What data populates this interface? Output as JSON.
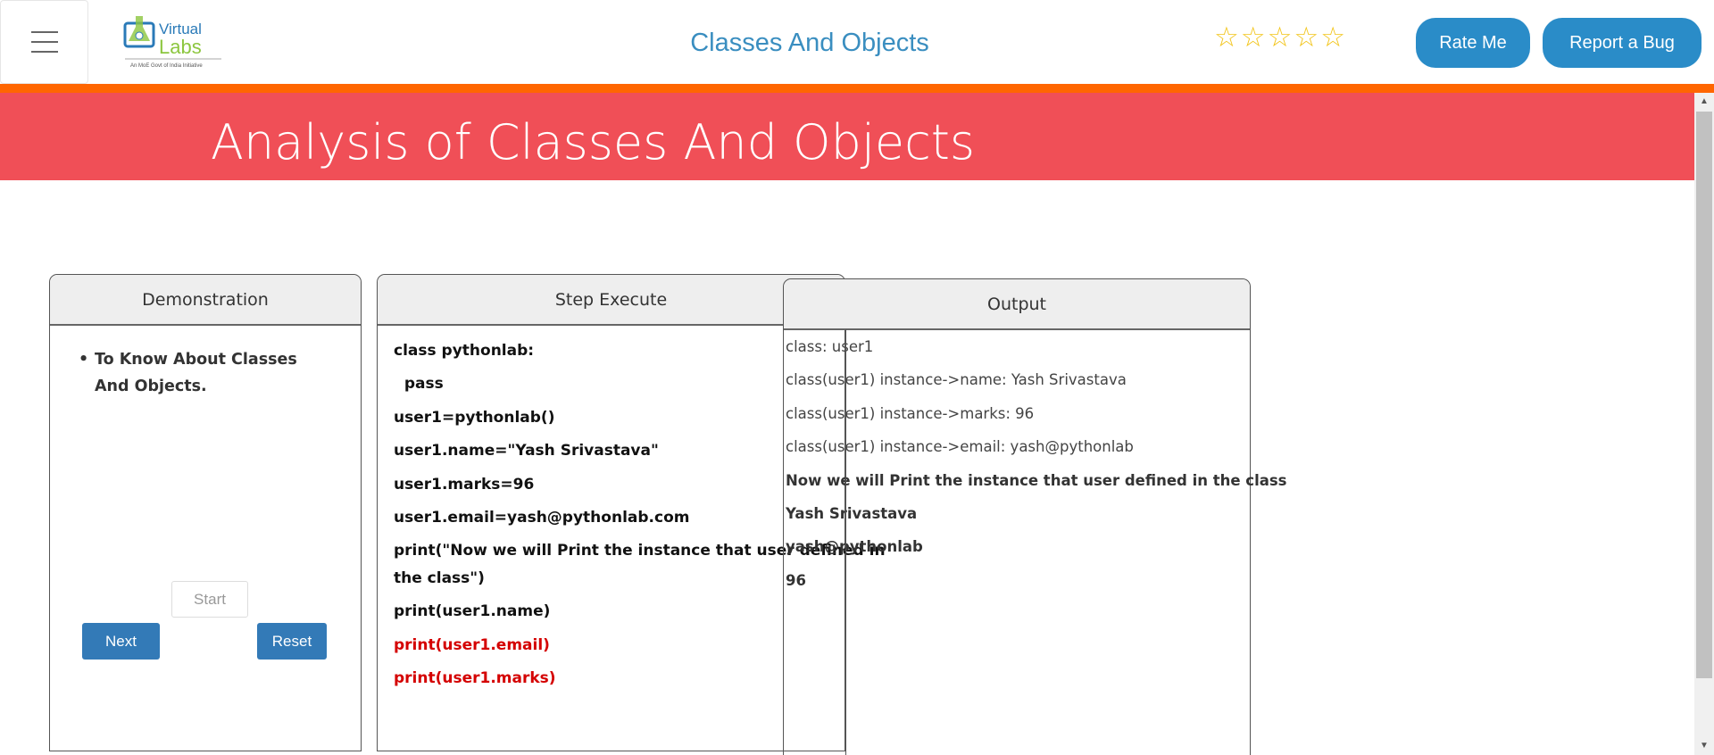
{
  "header": {
    "title": "Classes And Objects",
    "logo_text": "Virtual Labs",
    "logo_tagline": "An MoE Govt of India Initiative",
    "rating_stars": 5,
    "rating_value": 0,
    "rate_me": "Rate Me",
    "report_bug": "Report a Bug",
    "colors": {
      "title": "#3a8ec0",
      "buttons": "#2a8cc8",
      "accent_bar": "#ff6600"
    }
  },
  "banner": {
    "title": "Analysis of Classes And Objects",
    "color": "#f04f57"
  },
  "demonstration": {
    "heading": "Demonstration",
    "bullet": "To Know About Classes And Objects.",
    "start": "Start",
    "next": "Next",
    "reset": "Reset"
  },
  "step_execute": {
    "heading": "Step Execute",
    "lines": [
      {
        "text": "class pythonlab:",
        "highlight": false
      },
      {
        "text": "  pass",
        "highlight": false
      },
      {
        "text": "user1=pythonlab()",
        "highlight": false
      },
      {
        "text": "user1.name=\"Yash Srivastava\"",
        "highlight": false
      },
      {
        "text": "user1.marks=96",
        "highlight": false
      },
      {
        "text": "user1.email=yash@pythonlab.com",
        "highlight": false
      },
      {
        "text": "print(\"Now we will Print the instance that user defined in",
        "highlight": false
      },
      {
        "text": "the class\")",
        "highlight": false
      },
      {
        "text": "print(user1.name)",
        "highlight": false
      },
      {
        "text": "print(user1.email)",
        "highlight": true
      },
      {
        "text": "print(user1.marks)",
        "highlight": true
      }
    ]
  },
  "output": {
    "heading": "Output",
    "lines": [
      {
        "text": "class: user1",
        "bold": false
      },
      {
        "text": "class(user1) instance->name: Yash Srivastava",
        "bold": false
      },
      {
        "text": "class(user1) instance->marks: 96",
        "bold": false
      },
      {
        "text": "class(user1) instance->email: yash@pythonlab",
        "bold": false
      },
      {
        "text": "Now we will Print the instance that user defined in the class",
        "bold": true
      },
      {
        "text": "Yash Srivastava",
        "bold": true
      },
      {
        "text": "yash@pythonlab",
        "bold": true
      },
      {
        "text": "96",
        "bold": true
      }
    ]
  }
}
